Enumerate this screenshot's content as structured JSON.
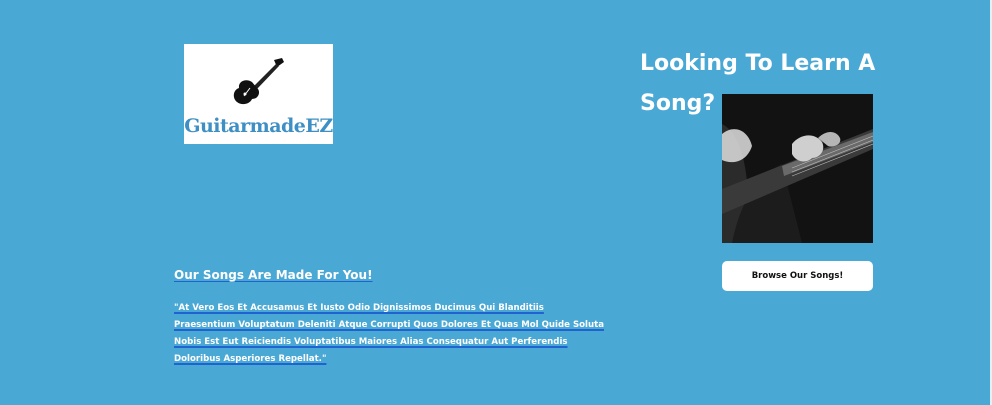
{
  "logo": {
    "text": "GuitarmadeEZ",
    "icon": "electric-guitar-icon",
    "text_color": "#3e8fc4"
  },
  "hero": {
    "title": "Looking To Learn A Song?",
    "image_alt": "guitar-player-photo",
    "cta_label": "Browse Our Songs!"
  },
  "content": {
    "subtitle": "Our Songs Are Made For You!",
    "quote": "\"At Vero Eos Et Accusamus Et Iusto Odio Dignissimos Ducimus Qui Blanditiis Praesentium Voluptatum Deleniti Atque Corrupti Quos Dolores Et Quas Mol Quide Soluta Nobis Est Eut Reiciendis Voluptatibus Maiores Alias Consequatur Aut Perferendis Doloribus Asperiores Repellat.\""
  },
  "colors": {
    "background": "#4aa8d5",
    "underline": "#1f63d1",
    "button_bg": "#ffffff"
  }
}
